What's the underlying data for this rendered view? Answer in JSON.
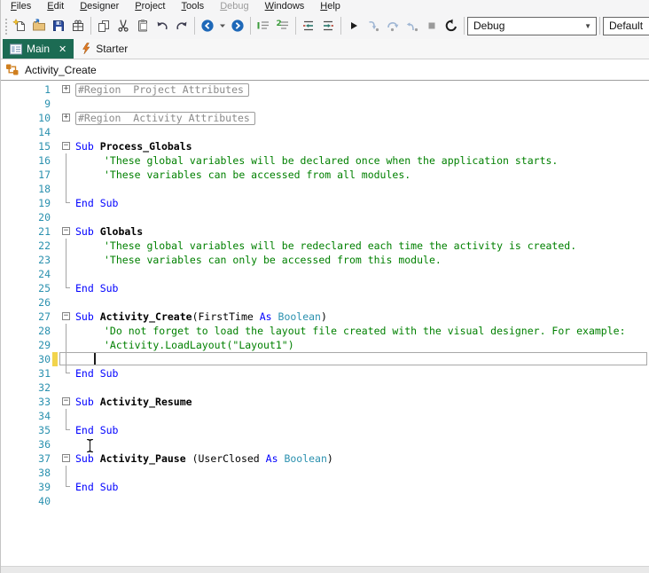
{
  "menu": {
    "items": [
      {
        "label": "Files",
        "enabled": true
      },
      {
        "label": "Edit",
        "enabled": true
      },
      {
        "label": "Designer",
        "enabled": true
      },
      {
        "label": "Project",
        "enabled": true
      },
      {
        "label": "Tools",
        "enabled": true
      },
      {
        "label": "Debug",
        "enabled": false
      },
      {
        "label": "Windows",
        "enabled": true
      },
      {
        "label": "Help",
        "enabled": true
      }
    ]
  },
  "toolbar": {
    "build_config": "Debug",
    "profile": "Default",
    "dropdown_glyph": "▼",
    "items": [
      {
        "type": "grip",
        "name": "toolbar-grip"
      },
      {
        "type": "button",
        "icon": "new-file",
        "enabled": true
      },
      {
        "type": "button",
        "icon": "open-project",
        "enabled": true
      },
      {
        "type": "button",
        "icon": "save",
        "enabled": true
      },
      {
        "type": "button",
        "icon": "package",
        "enabled": true
      },
      {
        "type": "sep"
      },
      {
        "type": "button",
        "icon": "copy",
        "enabled": true
      },
      {
        "type": "button",
        "icon": "cut",
        "enabled": true
      },
      {
        "type": "button",
        "icon": "paste",
        "enabled": true
      },
      {
        "type": "button",
        "icon": "undo",
        "enabled": true
      },
      {
        "type": "button",
        "icon": "redo",
        "enabled": true
      },
      {
        "type": "sep"
      },
      {
        "type": "button",
        "icon": "navigate-back",
        "enabled": true
      },
      {
        "type": "button",
        "icon": "back-dropdown",
        "enabled": true,
        "narrow": true
      },
      {
        "type": "button",
        "icon": "navigate-forward",
        "enabled": true
      },
      {
        "type": "sep"
      },
      {
        "type": "button",
        "icon": "comment",
        "enabled": true
      },
      {
        "type": "button",
        "icon": "uncomment",
        "enabled": true
      },
      {
        "type": "sep"
      },
      {
        "type": "button",
        "icon": "outdent",
        "enabled": true
      },
      {
        "type": "button",
        "icon": "indent",
        "enabled": true
      },
      {
        "type": "sep"
      },
      {
        "type": "button",
        "icon": "run",
        "enabled": true
      },
      {
        "type": "button",
        "icon": "step-into",
        "enabled": false
      },
      {
        "type": "button",
        "icon": "step-over",
        "enabled": false
      },
      {
        "type": "button",
        "icon": "step-out",
        "enabled": false
      },
      {
        "type": "button",
        "icon": "stop",
        "enabled": false
      },
      {
        "type": "button",
        "icon": "rebuild",
        "enabled": true
      },
      {
        "type": "sep"
      },
      {
        "type": "combo",
        "name": "build-configuration-select",
        "bind": "toolbar.build_config",
        "width": 146,
        "arrow": true
      },
      {
        "type": "sep"
      },
      {
        "type": "combo",
        "name": "profile-select",
        "bind": "toolbar.profile",
        "width": 95,
        "arrow": false
      }
    ]
  },
  "tabs": [
    {
      "label": "Main",
      "active": true,
      "icon": "form-icon",
      "close_glyph": "✕"
    },
    {
      "label": "Starter",
      "active": false,
      "icon": "lightning-icon"
    }
  ],
  "breadcrumb": {
    "label": "Activity_Create",
    "icon": "sub-navigator-icon"
  },
  "editor": {
    "colors": {
      "keyword": "#0000FF",
      "comment": "#008000",
      "type": "#2B91AF",
      "sub_name": "#000000",
      "region_text": "#8a8a8a",
      "line_number": "#2B91AF",
      "active_tab": "#1c6b53",
      "changed_line_marker": "#f2d44c",
      "current_line_border": "#a8a8a8"
    },
    "lines": [
      {
        "n": "1",
        "fold": "+",
        "region": true,
        "seg": [
          [
            "region",
            "#Region  Project Attributes"
          ]
        ]
      },
      {
        "n": "9"
      },
      {
        "n": "10",
        "fold": "+",
        "region": true,
        "seg": [
          [
            "region",
            "#Region  Activity Attributes"
          ]
        ]
      },
      {
        "n": "14"
      },
      {
        "n": "15",
        "fold": "−",
        "seg": [
          [
            "kw",
            "Sub "
          ],
          [
            "name",
            "Process_Globals"
          ]
        ]
      },
      {
        "n": "16",
        "guide": "mid",
        "ind": 1,
        "seg": [
          [
            "cmt",
            "'These global variables will be declared once when the application starts."
          ]
        ]
      },
      {
        "n": "17",
        "guide": "mid",
        "ind": 1,
        "seg": [
          [
            "cmt",
            "'These variables can be accessed from all modules."
          ]
        ]
      },
      {
        "n": "18",
        "guide": "mid"
      },
      {
        "n": "19",
        "guide": "end",
        "seg": [
          [
            "kw",
            "End Sub"
          ]
        ]
      },
      {
        "n": "20"
      },
      {
        "n": "21",
        "fold": "−",
        "seg": [
          [
            "kw",
            "Sub "
          ],
          [
            "name",
            "Globals"
          ]
        ]
      },
      {
        "n": "22",
        "guide": "mid",
        "ind": 1,
        "seg": [
          [
            "cmt",
            "'These global variables will be redeclared each time the activity is created."
          ]
        ]
      },
      {
        "n": "23",
        "guide": "mid",
        "ind": 1,
        "seg": [
          [
            "cmt",
            "'These variables can only be accessed from this module."
          ]
        ]
      },
      {
        "n": "24",
        "guide": "mid"
      },
      {
        "n": "25",
        "guide": "end",
        "seg": [
          [
            "kw",
            "End Sub"
          ]
        ]
      },
      {
        "n": "26"
      },
      {
        "n": "27",
        "fold": "−",
        "seg": [
          [
            "kw",
            "Sub "
          ],
          [
            "name",
            "Activity_Create"
          ],
          [
            "pln",
            "(FirstTime "
          ],
          [
            "kw",
            "As "
          ],
          [
            "typ",
            "Boolean"
          ],
          [
            "pln",
            ")"
          ]
        ]
      },
      {
        "n": "28",
        "guide": "mid",
        "ind": 1,
        "seg": [
          [
            "cmt",
            "'Do not forget to load the layout file created with the visual designer. For example:"
          ]
        ]
      },
      {
        "n": "29",
        "guide": "mid",
        "ind": 1,
        "seg": [
          [
            "cmt",
            "'Activity.LoadLayout(\"Layout1\")"
          ]
        ]
      },
      {
        "n": "30",
        "guide": "mid",
        "current": true,
        "changed": true
      },
      {
        "n": "31",
        "guide": "end",
        "seg": [
          [
            "kw",
            "End Sub"
          ]
        ]
      },
      {
        "n": "32"
      },
      {
        "n": "33",
        "fold": "−",
        "seg": [
          [
            "kw",
            "Sub "
          ],
          [
            "name",
            "Activity_Resume"
          ]
        ]
      },
      {
        "n": "34",
        "guide": "mid"
      },
      {
        "n": "35",
        "guide": "end",
        "seg": [
          [
            "kw",
            "End Sub"
          ]
        ]
      },
      {
        "n": "36"
      },
      {
        "n": "37",
        "fold": "−",
        "seg": [
          [
            "kw",
            "Sub "
          ],
          [
            "name",
            "Activity_Pause "
          ],
          [
            "pln",
            "(UserClosed "
          ],
          [
            "kw",
            "As "
          ],
          [
            "typ",
            "Boolean"
          ],
          [
            "pln",
            ")"
          ]
        ]
      },
      {
        "n": "38",
        "guide": "mid"
      },
      {
        "n": "39",
        "guide": "end",
        "seg": [
          [
            "kw",
            "End Sub"
          ]
        ]
      },
      {
        "n": "40"
      }
    ]
  }
}
